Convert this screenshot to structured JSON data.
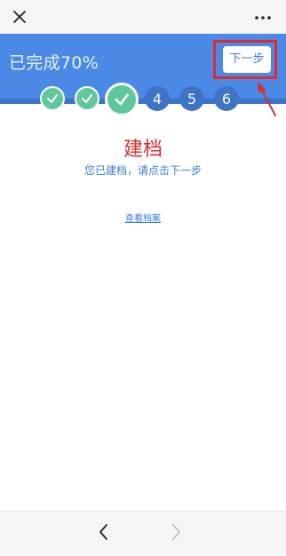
{
  "header": {
    "close_icon": "close-icon",
    "more_icon": "more-icon"
  },
  "progress": {
    "text": "已完成70%",
    "value_percent": 70
  },
  "next_button": {
    "label": "下一步"
  },
  "steps": [
    {
      "status": "done",
      "icon": "check-icon"
    },
    {
      "status": "done",
      "icon": "check-icon"
    },
    {
      "status": "current",
      "icon": "check-icon"
    },
    {
      "status": "todo",
      "label": "4"
    },
    {
      "status": "todo",
      "label": "5"
    },
    {
      "status": "todo",
      "label": "6"
    }
  ],
  "content": {
    "title": "建档",
    "subtitle": "您已建档，请点击下一步",
    "view_link": "查看档案"
  },
  "footer": {
    "back_icon": "chevron-left-icon",
    "forward_icon": "chevron-right-icon"
  },
  "colors": {
    "banner": "#4a8ae6",
    "step_done": "#5fc89a",
    "step_todo": "#3f73c5",
    "title": "#d62d2d",
    "link": "#3b7fd4",
    "highlight": "#e02a2a"
  }
}
